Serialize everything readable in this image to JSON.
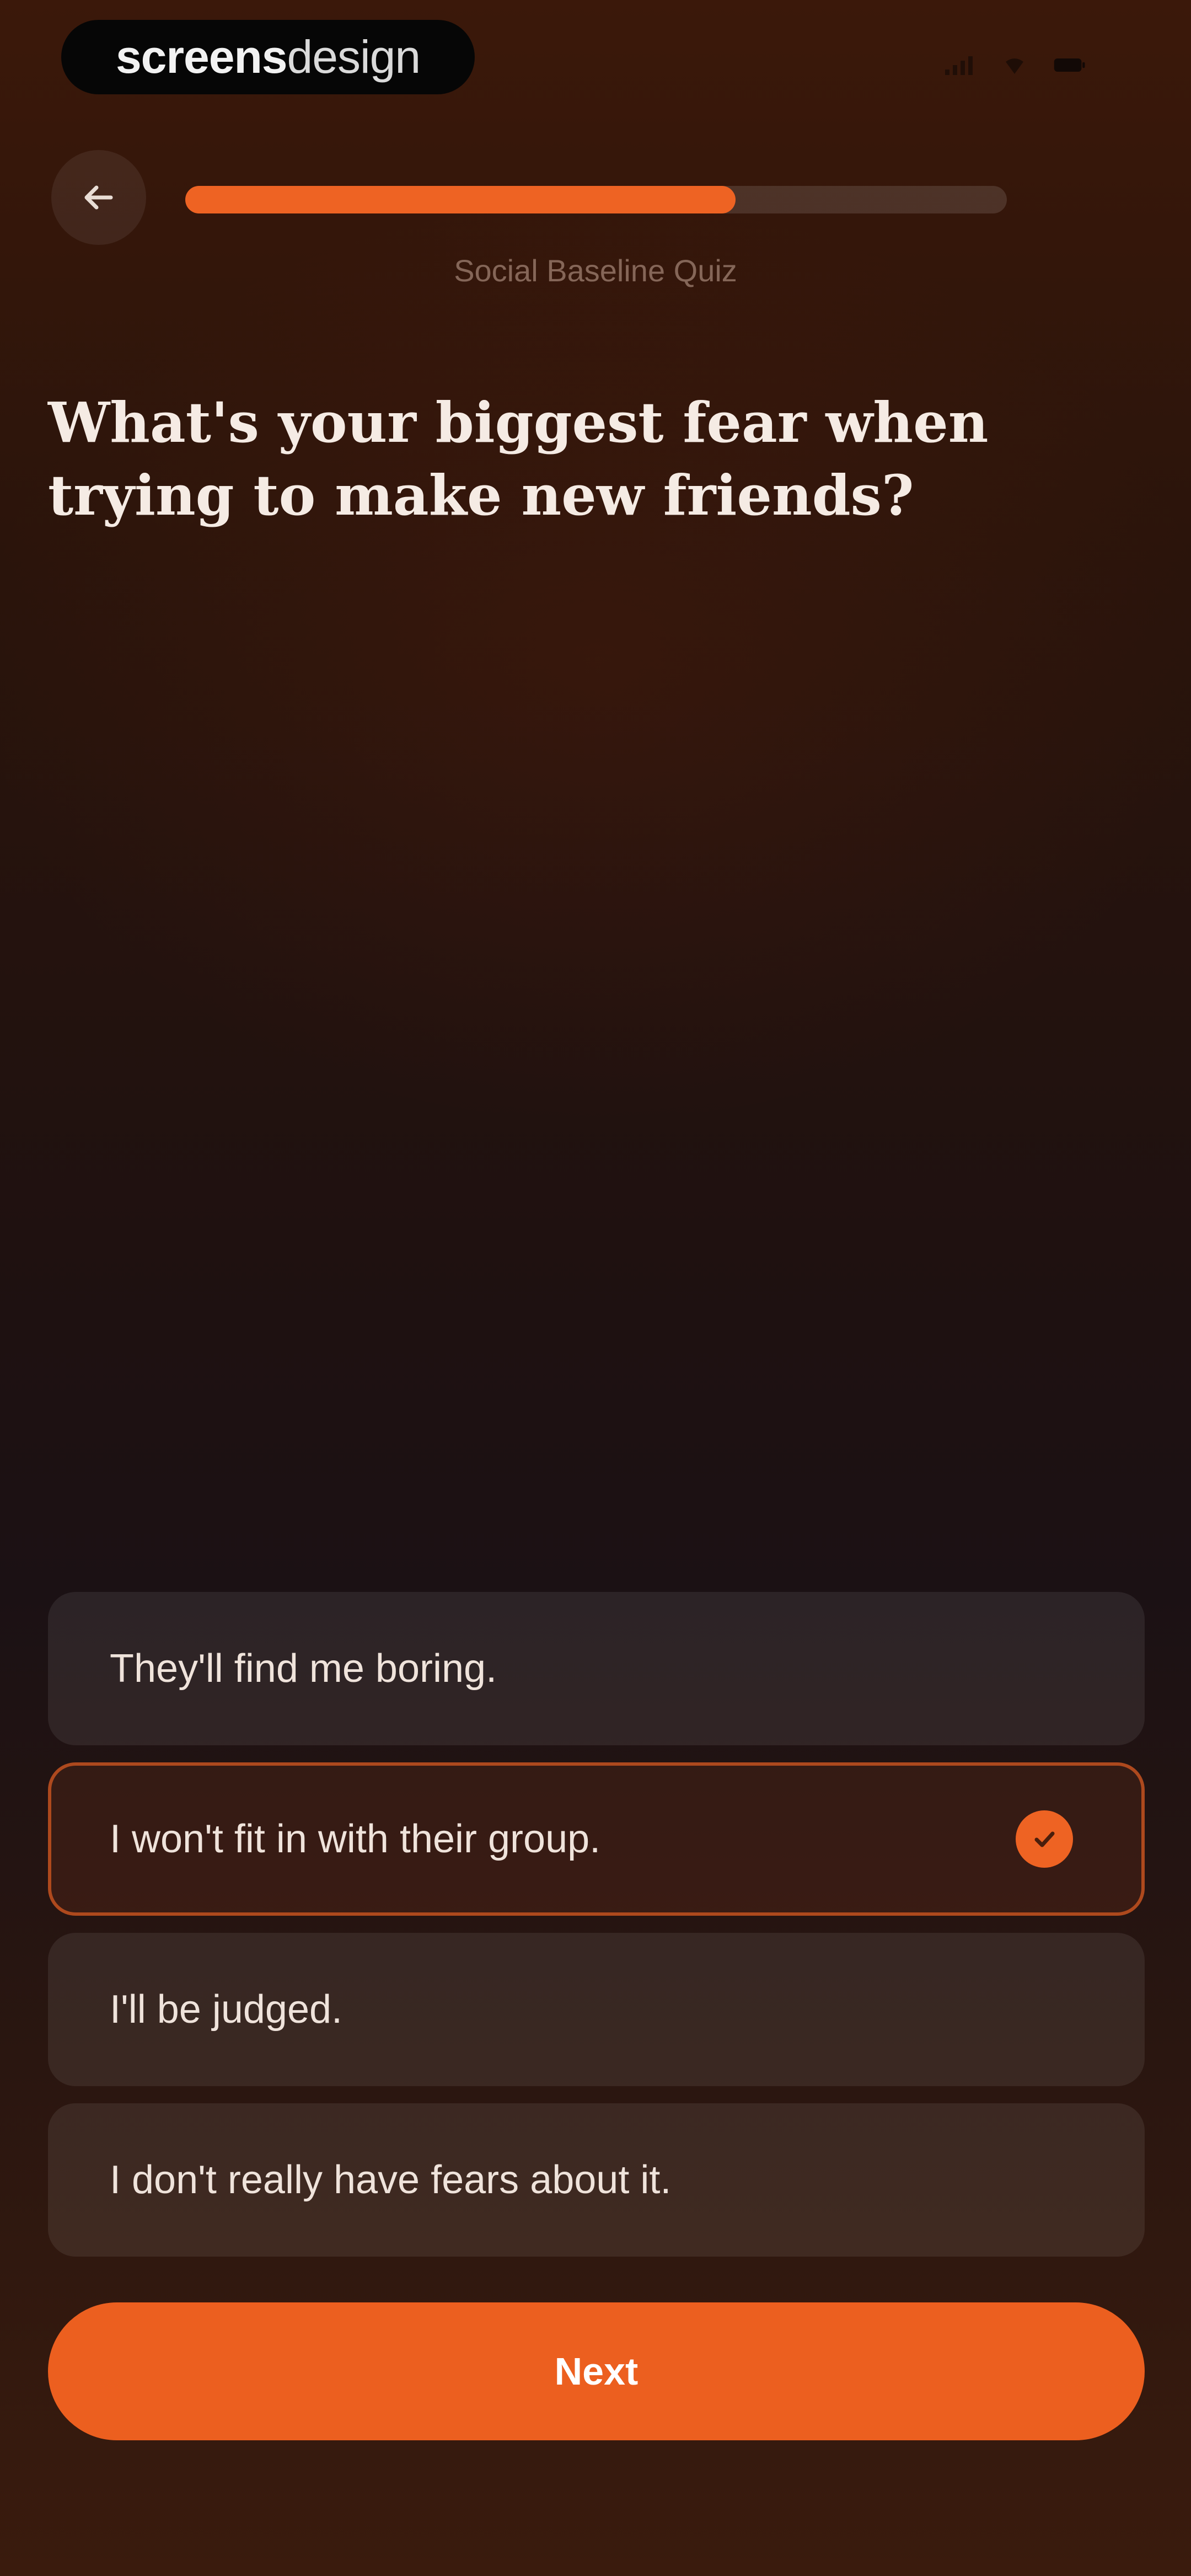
{
  "status_bar": {
    "watermark_bold": "screens",
    "watermark_light": "design",
    "icons": [
      "signal-icon",
      "wifi-icon",
      "battery-icon"
    ]
  },
  "header": {
    "back_icon": "arrow-left-icon",
    "progress_fraction": 0.67,
    "subtitle": "Social Baseline Quiz"
  },
  "question": {
    "line1": "What's your biggest fear when",
    "line2": "trying to make new friends?"
  },
  "options": [
    {
      "label": "They'll find me boring.",
      "selected": false
    },
    {
      "label": "I won't fit in with their group.",
      "selected": true
    },
    {
      "label": "I'll be judged.",
      "selected": false
    },
    {
      "label": "I don't really have fears about it.",
      "selected": false
    }
  ],
  "next_button": {
    "label": "Next"
  },
  "colors": {
    "accent": "#ee6323",
    "background_top": "#3b180a",
    "background_mid": "#1f1110",
    "text": "#f3e7e0"
  }
}
